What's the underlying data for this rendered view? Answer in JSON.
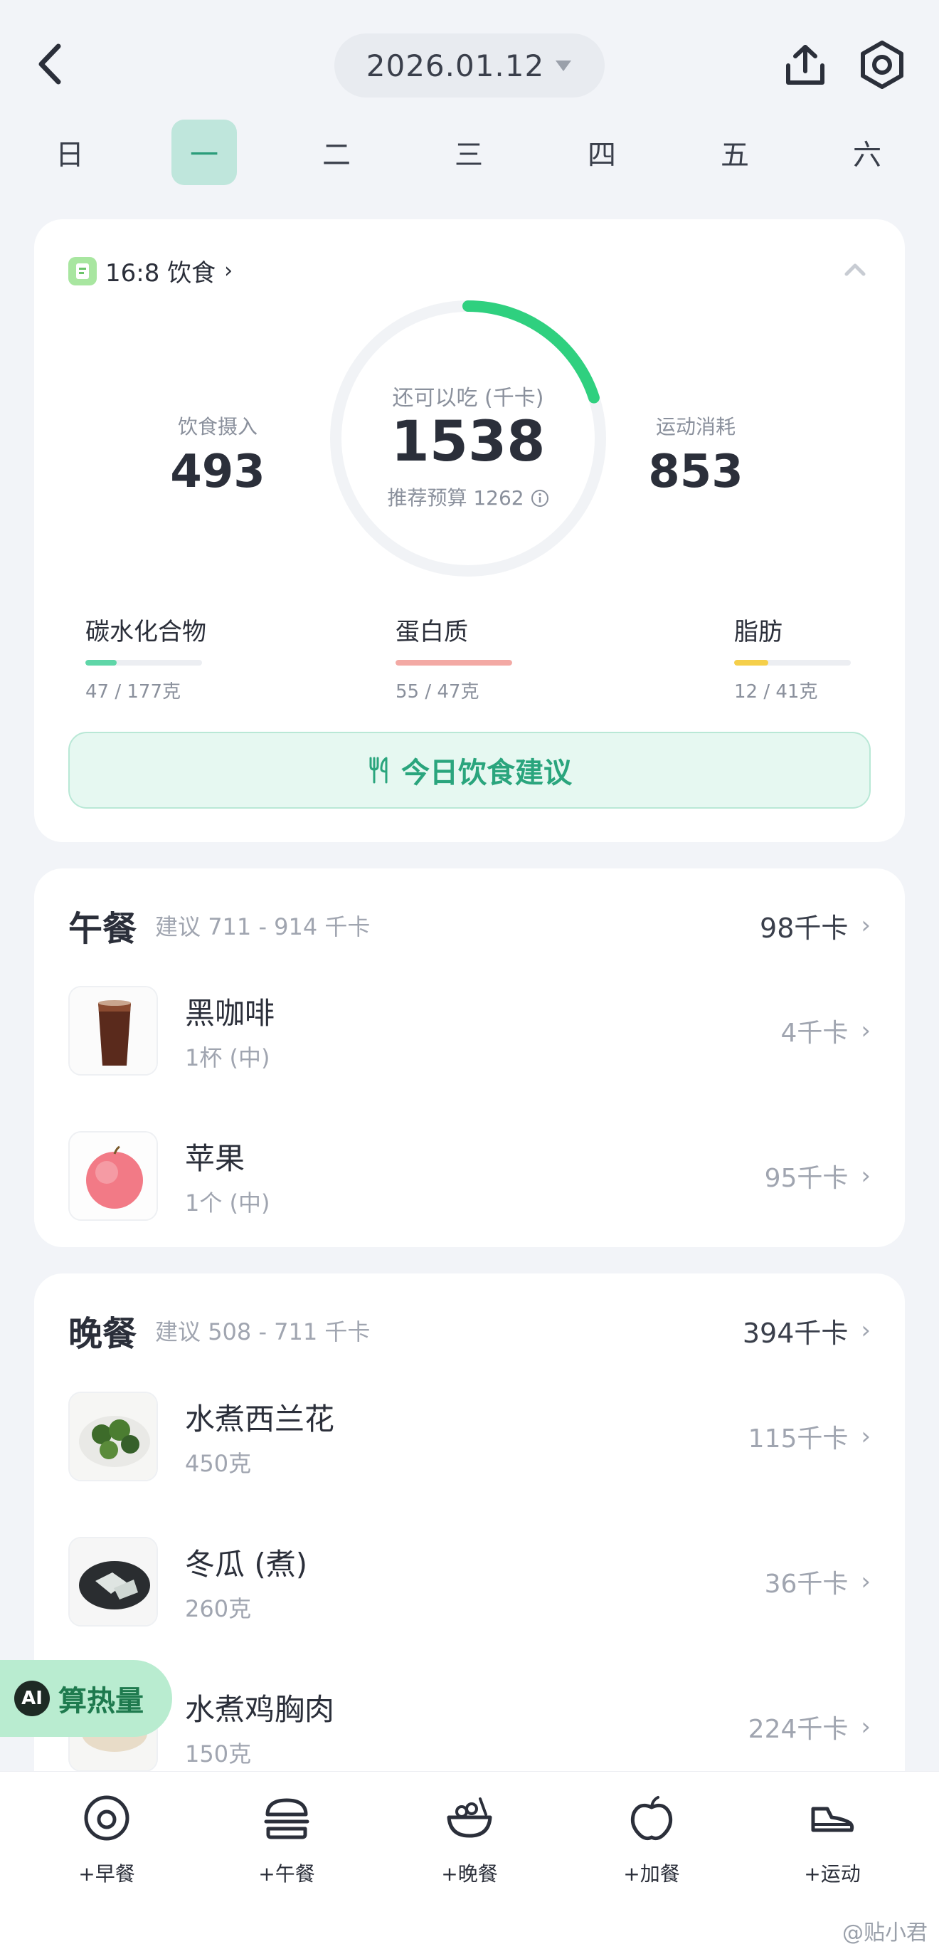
{
  "header": {
    "date": "2026.01.12",
    "back_icon": "chevron-left-icon",
    "share_icon": "share-icon",
    "settings_icon": "settings-icon"
  },
  "week": {
    "days": [
      "日",
      "一",
      "二",
      "三",
      "四",
      "五",
      "六"
    ],
    "selected_index": 1
  },
  "summary": {
    "plan_label": "16:8 饮食",
    "intake_label": "饮食摄入",
    "intake_value": "493",
    "remaining_label": "还可以吃 (千卡)",
    "remaining_value": "1538",
    "budget_label": "推荐预算 1262",
    "burn_label": "运动消耗",
    "burn_value": "853",
    "ring_progress": 0.2,
    "accent_color": "#2fd07f",
    "macros": {
      "carb": {
        "name": "碳水化合物",
        "amount": "47 / 177克",
        "fraction": 0.27,
        "color": "#5fd6a8"
      },
      "protein": {
        "name": "蛋白质",
        "amount": "55 / 47克",
        "fraction": 1.0,
        "color": "#f3a9a4"
      },
      "fat": {
        "name": "脂肪",
        "amount": "12 / 41克",
        "fraction": 0.29,
        "color": "#f5cf4a"
      }
    },
    "advice_label": "今日饮食建议"
  },
  "lunch": {
    "title": "午餐",
    "hint": "建议 711 - 914 千卡",
    "kcal": "98千卡",
    "items": [
      {
        "name": "黑咖啡",
        "qty": "1杯 (中)",
        "kcal": "4千卡",
        "thumb": "coffee"
      },
      {
        "name": "苹果",
        "qty": "1个 (中)",
        "kcal": "95千卡",
        "thumb": "apple"
      }
    ]
  },
  "dinner": {
    "title": "晚餐",
    "hint": "建议 508 - 711 千卡",
    "kcal": "394千卡",
    "items": [
      {
        "name": "水煮西兰花",
        "qty": "450克",
        "kcal": "115千卡",
        "thumb": "broccoli"
      },
      {
        "name": "冬瓜 (煮)",
        "qty": "260克",
        "kcal": "36千卡",
        "thumb": "wintermelon"
      },
      {
        "name": "水煮鸡胸肉",
        "qty": "150克",
        "kcal": "224千卡",
        "thumb": "chicken"
      }
    ]
  },
  "ai_button": {
    "badge": "AI",
    "label": "算热量"
  },
  "bottom_bar": {
    "items": [
      {
        "label": "+早餐",
        "icon": "egg-icon"
      },
      {
        "label": "+午餐",
        "icon": "burger-icon"
      },
      {
        "label": "+晚餐",
        "icon": "bowl-icon"
      },
      {
        "label": "+加餐",
        "icon": "apple-icon"
      },
      {
        "label": "+运动",
        "icon": "sneaker-icon"
      }
    ]
  },
  "watermark": "@贴小君"
}
